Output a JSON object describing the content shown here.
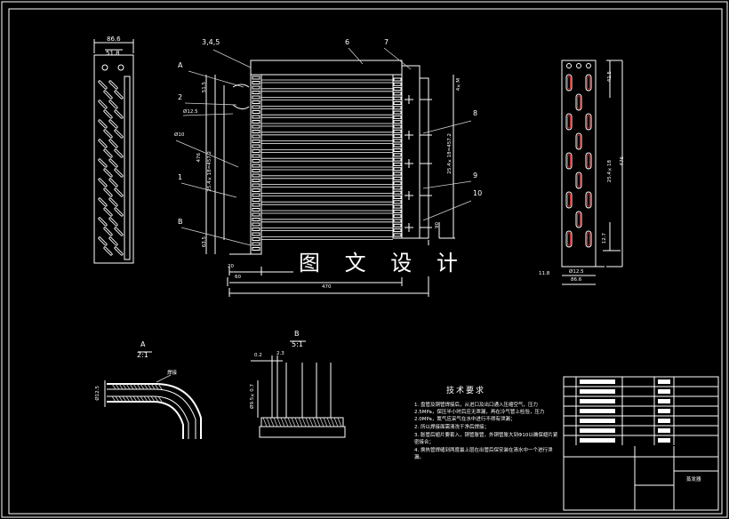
{
  "watermark": "图 文 设 计",
  "left_view": {
    "dim_top": "86.6",
    "dim_top2": "51.8"
  },
  "front_view": {
    "callouts": [
      "3,4,5",
      "6",
      "7",
      "A",
      "2",
      "1",
      "B",
      "8",
      "9",
      "10"
    ],
    "dims": {
      "d1": "51.5",
      "d2": "Ø12.5",
      "d3": "Ø10",
      "d4": "476",
      "d5": "25.4×18=457.2",
      "d6": "63.5",
      "d7": "20",
      "d8": "60",
      "d9": "470",
      "d10": "25.4×18=457.2",
      "d11": "90",
      "d12": "4×M"
    }
  },
  "right_view": {
    "dims": {
      "r1": "41.5",
      "r2": "25.4×18",
      "r3": "476",
      "r4": "12.7",
      "r5": "11.8",
      "r6": "86.6",
      "r7": "Ø12.5"
    }
  },
  "detail_a": {
    "label": "A",
    "scale": "2:1",
    "note": "焊接",
    "dim": "Ø12.5"
  },
  "detail_b": {
    "label": "B",
    "scale": "5:1",
    "dim1": "0.2",
    "dim2": "2.3",
    "dim3": "Ø9.5×0.7"
  },
  "tech_req": {
    "title": "技术要求",
    "items": [
      "1. 盘管及铜管焊接后，从进口及出口通入压缩空气，压力2.5MPa，保压半小时后应无泄漏，再在冷气管上检验，压力2.0MPa，氮气应采气在水中进行不得有泄漏；",
      "2. 所以焊接面需清洗干净后焊接；",
      "3. 胀管后翅片要套入，铜管胀管，外铜管胀大到Φ10以确保翅片紧密接合；",
      "4. 换热管焊缝到两度最上层在出管后保安装在清水中一个进行泄漏。"
    ]
  },
  "title_block": {
    "name": "蒸发器"
  }
}
